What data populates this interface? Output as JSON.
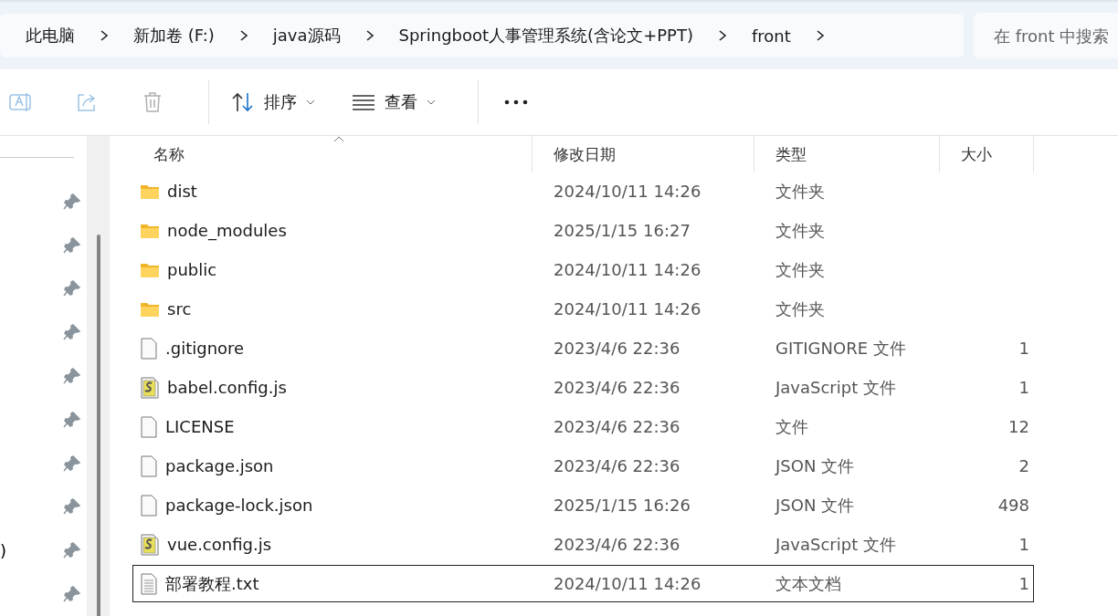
{
  "breadcrumb": [
    "此电脑",
    "新加卷 (F:)",
    "java源码",
    "Springboot人事管理系统(含论文+PPT)",
    "front"
  ],
  "search": {
    "placeholder": "在 front 中搜索"
  },
  "toolbar": {
    "sort": "排序",
    "view": "查看"
  },
  "sidebar": {
    "items": [
      {
        "pinned": true
      },
      {
        "pinned": true
      },
      {
        "pinned": true
      },
      {
        "pinned": true
      },
      {
        "pinned": true
      },
      {
        "pinned": true
      },
      {
        "pinned": true
      },
      {
        "pinned": true
      },
      {
        "label": ")",
        "pinned": true
      },
      {
        "pinned": true
      }
    ]
  },
  "columns": [
    "名称",
    "修改日期",
    "类型",
    "大小"
  ],
  "rows": [
    {
      "kind": "folder",
      "name": "dist",
      "date": "2024/10/11 14:26",
      "type": "文件夹",
      "focused": false
    },
    {
      "kind": "folder",
      "name": "node_modules",
      "date": "2025/1/15 16:27",
      "type": "文件夹",
      "focused": false
    },
    {
      "kind": "folder",
      "name": "public",
      "date": "2024/10/11 14:26",
      "type": "文件夹",
      "focused": false
    },
    {
      "kind": "folder",
      "name": "src",
      "date": "2024/10/11 14:26",
      "type": "文件夹",
      "focused": false
    },
    {
      "kind": "file",
      "name": ".gitignore",
      "date": "2023/4/6 22:36",
      "type": "GITIGNORE 文件",
      "size": "1",
      "focused": false
    },
    {
      "kind": "script",
      "name": "babel.config.js",
      "date": "2023/4/6 22:36",
      "type": "JavaScript 文件",
      "size": "1",
      "focused": false
    },
    {
      "kind": "file",
      "name": "LICENSE",
      "date": "2023/4/6 22:36",
      "type": "文件",
      "size": "12",
      "focused": false
    },
    {
      "kind": "file",
      "name": "package.json",
      "date": "2023/4/6 22:36",
      "type": "JSON 文件",
      "size": "2",
      "focused": false
    },
    {
      "kind": "file",
      "name": "package-lock.json",
      "date": "2025/1/15 16:26",
      "type": "JSON 文件",
      "size": "498",
      "focused": false
    },
    {
      "kind": "script",
      "name": "vue.config.js",
      "date": "2023/4/6 22:36",
      "type": "JavaScript 文件",
      "size": "1",
      "focused": false
    },
    {
      "kind": "text",
      "name": "部署教程.txt",
      "date": "2024/10/11 14:26",
      "type": "文本文档",
      "size": "1",
      "focused": true
    }
  ]
}
